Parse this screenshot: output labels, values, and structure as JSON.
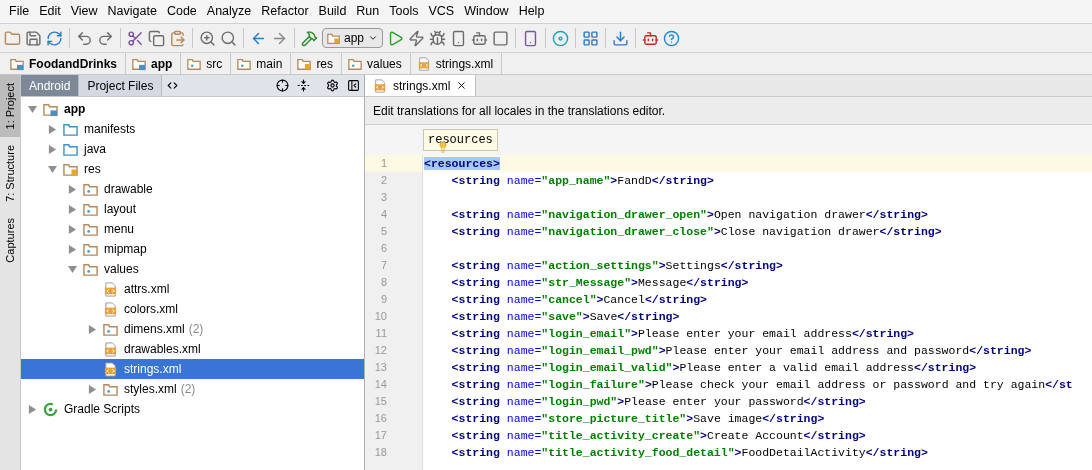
{
  "menu": [
    "File",
    "Edit",
    "View",
    "Navigate",
    "Code",
    "Analyze",
    "Refactor",
    "Build",
    "Run",
    "Tools",
    "VCS",
    "Window",
    "Help"
  ],
  "toolbar": {
    "run_config": "app"
  },
  "breadcrumb": [
    {
      "label": "FoodandDrinks",
      "kind": "project"
    },
    {
      "label": "app",
      "kind": "module"
    },
    {
      "label": "src",
      "kind": "folder"
    },
    {
      "label": "main",
      "kind": "folder"
    },
    {
      "label": "res",
      "kind": "res"
    },
    {
      "label": "values",
      "kind": "folder"
    },
    {
      "label": "strings.xml",
      "kind": "xml"
    }
  ],
  "tool_strip": [
    {
      "label": "1: Project",
      "selected": true
    },
    {
      "label": "7: Structure",
      "selected": false
    },
    {
      "label": "Captures",
      "selected": false
    }
  ],
  "project_panel": {
    "views": [
      {
        "label": "Android",
        "selected": true
      },
      {
        "label": "Project Files",
        "selected": false
      }
    ],
    "tree": [
      {
        "label": "app",
        "kind": "module",
        "expanded": true,
        "selected": false,
        "children": [
          {
            "label": "manifests",
            "kind": "source",
            "expanded": false,
            "selected": false
          },
          {
            "label": "java",
            "kind": "source",
            "expanded": false,
            "selected": false
          },
          {
            "label": "res",
            "kind": "res",
            "expanded": true,
            "selected": false,
            "children": [
              {
                "label": "drawable",
                "kind": "folder",
                "expanded": false,
                "selected": false
              },
              {
                "label": "layout",
                "kind": "folder",
                "expanded": false,
                "selected": false
              },
              {
                "label": "menu",
                "kind": "folder",
                "expanded": false,
                "selected": false
              },
              {
                "label": "mipmap",
                "kind": "folder",
                "expanded": false,
                "selected": false
              },
              {
                "label": "values",
                "kind": "folder",
                "expanded": true,
                "selected": false,
                "children": [
                  {
                    "label": "attrs.xml",
                    "kind": "xml",
                    "selected": false
                  },
                  {
                    "label": "colors.xml",
                    "kind": "xml",
                    "selected": false
                  },
                  {
                    "label": "dimens.xml",
                    "count": "(2)",
                    "kind": "folder",
                    "expanded": false,
                    "selected": false
                  },
                  {
                    "label": "drawables.xml",
                    "kind": "xml",
                    "selected": false
                  },
                  {
                    "label": "strings.xml",
                    "kind": "xml",
                    "selected": true
                  },
                  {
                    "label": "styles.xml",
                    "count": "(2)",
                    "kind": "folder",
                    "expanded": false,
                    "selected": false
                  }
                ]
              }
            ]
          }
        ]
      },
      {
        "label": "Gradle Scripts",
        "kind": "gradle",
        "expanded": false,
        "selected": false
      }
    ]
  },
  "editor": {
    "tabs": [
      {
        "label": "strings.xml",
        "selected": true
      }
    ],
    "banner": "Edit translations for all locales in the translations editor.",
    "tooltip": "resources",
    "lines": [
      {
        "number": "1",
        "current": true,
        "tokens": [
          {
            "kind": "tag",
            "text": "<resources>",
            "selected": true
          }
        ]
      },
      {
        "number": "2",
        "current": false,
        "tokens": [
          {
            "kind": "tag",
            "text": "    <string "
          },
          {
            "kind": "attr",
            "text": "name="
          },
          {
            "kind": "value",
            "text": "\"app_name\""
          },
          {
            "kind": "tag",
            "text": ">"
          },
          {
            "kind": "text",
            "text": "FandD"
          },
          {
            "kind": "tag",
            "text": "</string>"
          }
        ]
      },
      {
        "number": "3",
        "current": false
      },
      {
        "number": "4",
        "current": false,
        "tokens": [
          {
            "kind": "tag",
            "text": "    <string "
          },
          {
            "kind": "attr",
            "text": "name="
          },
          {
            "kind": "value",
            "text": "\"navigation_drawer_open\""
          },
          {
            "kind": "tag",
            "text": ">"
          },
          {
            "kind": "text",
            "text": "Open navigation drawer"
          },
          {
            "kind": "tag",
            "text": "</string>"
          }
        ]
      },
      {
        "number": "5",
        "current": false,
        "tokens": [
          {
            "kind": "tag",
            "text": "    <string "
          },
          {
            "kind": "attr",
            "text": "name="
          },
          {
            "kind": "value",
            "text": "\"navigation_drawer_close\""
          },
          {
            "kind": "tag",
            "text": ">"
          },
          {
            "kind": "text",
            "text": "Close navigation drawer"
          },
          {
            "kind": "tag",
            "text": "</string>"
          }
        ]
      },
      {
        "number": "6",
        "current": false
      },
      {
        "number": "7",
        "current": false,
        "tokens": [
          {
            "kind": "tag",
            "text": "    <string "
          },
          {
            "kind": "attr",
            "text": "name="
          },
          {
            "kind": "value",
            "text": "\"action_settings\""
          },
          {
            "kind": "tag",
            "text": ">"
          },
          {
            "kind": "text",
            "text": "Settings"
          },
          {
            "kind": "tag",
            "text": "</string>"
          }
        ]
      },
      {
        "number": "8",
        "current": false,
        "tokens": [
          {
            "kind": "tag",
            "text": "    <string "
          },
          {
            "kind": "attr",
            "text": "name="
          },
          {
            "kind": "value",
            "text": "\"str_Message\""
          },
          {
            "kind": "tag",
            "text": ">"
          },
          {
            "kind": "text",
            "text": "Message"
          },
          {
            "kind": "tag",
            "text": "</string>"
          }
        ]
      },
      {
        "number": "9",
        "current": false,
        "tokens": [
          {
            "kind": "tag",
            "text": "    <string "
          },
          {
            "kind": "attr",
            "text": "name="
          },
          {
            "kind": "value",
            "text": "\"cancel\""
          },
          {
            "kind": "tag",
            "text": ">"
          },
          {
            "kind": "text",
            "text": "Cancel"
          },
          {
            "kind": "tag",
            "text": "</string>"
          }
        ]
      },
      {
        "number": "10",
        "current": false,
        "tokens": [
          {
            "kind": "tag",
            "text": "    <string "
          },
          {
            "kind": "attr",
            "text": "name="
          },
          {
            "kind": "value",
            "text": "\"save\""
          },
          {
            "kind": "tag",
            "text": ">"
          },
          {
            "kind": "text",
            "text": "Save"
          },
          {
            "kind": "tag",
            "text": "</string>"
          }
        ]
      },
      {
        "number": "11",
        "current": false,
        "tokens": [
          {
            "kind": "tag",
            "text": "    <string "
          },
          {
            "kind": "attr",
            "text": "name="
          },
          {
            "kind": "value",
            "text": "\"login_email\""
          },
          {
            "kind": "tag",
            "text": ">"
          },
          {
            "kind": "text",
            "text": "Please enter your email address"
          },
          {
            "kind": "tag",
            "text": "</string>"
          }
        ]
      },
      {
        "number": "12",
        "current": false,
        "tokens": [
          {
            "kind": "tag",
            "text": "    <string "
          },
          {
            "kind": "attr",
            "text": "name="
          },
          {
            "kind": "value",
            "text": "\"login_email_pwd\""
          },
          {
            "kind": "tag",
            "text": ">"
          },
          {
            "kind": "text",
            "text": "Please enter your email address and password"
          },
          {
            "kind": "tag",
            "text": "</string>"
          }
        ]
      },
      {
        "number": "13",
        "current": false,
        "tokens": [
          {
            "kind": "tag",
            "text": "    <string "
          },
          {
            "kind": "attr",
            "text": "name="
          },
          {
            "kind": "value",
            "text": "\"login_email_valid\""
          },
          {
            "kind": "tag",
            "text": ">"
          },
          {
            "kind": "text",
            "text": "Please enter a valid email address"
          },
          {
            "kind": "tag",
            "text": "</string>"
          }
        ]
      },
      {
        "number": "14",
        "current": false,
        "tokens": [
          {
            "kind": "tag",
            "text": "    <string "
          },
          {
            "kind": "attr",
            "text": "name="
          },
          {
            "kind": "value",
            "text": "\"login_failure\""
          },
          {
            "kind": "tag",
            "text": ">"
          },
          {
            "kind": "text",
            "text": "Please check your email address or password and try again"
          },
          {
            "kind": "tag",
            "text": "</st"
          }
        ]
      },
      {
        "number": "15",
        "current": false,
        "tokens": [
          {
            "kind": "tag",
            "text": "    <string "
          },
          {
            "kind": "attr",
            "text": "name="
          },
          {
            "kind": "value",
            "text": "\"login_pwd\""
          },
          {
            "kind": "tag",
            "text": ">"
          },
          {
            "kind": "text",
            "text": "Please enter your password"
          },
          {
            "kind": "tag",
            "text": "</string>"
          }
        ]
      },
      {
        "number": "16",
        "current": false,
        "tokens": [
          {
            "kind": "tag",
            "text": "    <string "
          },
          {
            "kind": "attr",
            "text": "name="
          },
          {
            "kind": "value",
            "text": "\"store_picture_title\""
          },
          {
            "kind": "tag",
            "text": ">"
          },
          {
            "kind": "text",
            "text": "Save image"
          },
          {
            "kind": "tag",
            "text": "</string>"
          }
        ]
      },
      {
        "number": "17",
        "current": false,
        "tokens": [
          {
            "kind": "tag",
            "text": "    <string "
          },
          {
            "kind": "attr",
            "text": "name="
          },
          {
            "kind": "value",
            "text": "\"title_activity_create\""
          },
          {
            "kind": "tag",
            "text": ">"
          },
          {
            "kind": "text",
            "text": "Create Account"
          },
          {
            "kind": "tag",
            "text": "</string>"
          }
        ]
      },
      {
        "number": "18",
        "current": false,
        "tokens": [
          {
            "kind": "tag",
            "text": "    <string "
          },
          {
            "kind": "attr",
            "text": "name="
          },
          {
            "kind": "value",
            "text": "\"title_activity_food_detail\""
          },
          {
            "kind": "tag",
            "text": ">"
          },
          {
            "kind": "text",
            "text": "FoodDetailActivity"
          },
          {
            "kind": "tag",
            "text": "</string>"
          }
        ]
      }
    ]
  }
}
